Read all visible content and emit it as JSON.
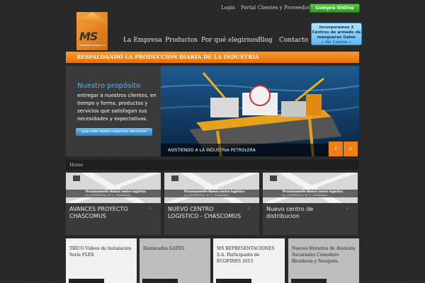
{
  "topbar": {
    "links": [
      "Login",
      "Portal Clientes y Proveedores"
    ],
    "buy_button": "Compra Online"
  },
  "logo": {
    "brand": "MS",
    "subtitle": "REPRESENTACIONES S.A."
  },
  "nav": [
    "La Empresa",
    "Productos",
    "Por qué elegirnos",
    "Blog",
    "Contacto"
  ],
  "promo": {
    "text": "Incorporamos 3 Centros de armado de mangueras Gates",
    "link": "» Ver Centros «"
  },
  "banner": "RESPALDANDO LA PRODUCCION DIARIA DE LA INDUSTRIA",
  "slider": {
    "title": "Nuestro propósito",
    "text": "entregar a nuestros clientes, en tiempo y forma, productos y servicios que satisfagan sus necesidades y expectativas.",
    "button": "Lea más sobre nuestros servicios",
    "caption": "ASISTIENDO A LA INDUSTRIA PETROLERA",
    "prev": "‹",
    "next": "›"
  },
  "breadcrumb": "Home",
  "cards": [
    {
      "title": "AVANCES PROYECTO CHASCOMUS",
      "map_band": "Proximamente Nuevo centro logistico",
      "map_sub": "Av. 1/3 Ruta Prov. N° 2 - Chascomus"
    },
    {
      "title": "NUEVO CENTRO LOGISTICO - CHASCOMUS",
      "map_band": "Proximamente Nuevo centro logistico",
      "map_sub": "Av. 1/3 Ruta Prov. N° 2 - Chascomus"
    },
    {
      "title": "Nuevo centro de distribucion",
      "map_band": "Proximamente Nuevo centro logistico",
      "map_sub": "Av. 1/3 Ruta Prov. N° 2 - Chascomus"
    }
  ],
  "chevron": "›",
  "news": [
    "TRICO Videos de Instalacion Serie FLEX",
    "Destacados GATES",
    "MS REPRESENTACIONES S.A. Participante de ECOFINES 2015",
    "Nuevos Horarios de Atención Sucursales Comodoro Rivadavia y Neuquén."
  ]
}
